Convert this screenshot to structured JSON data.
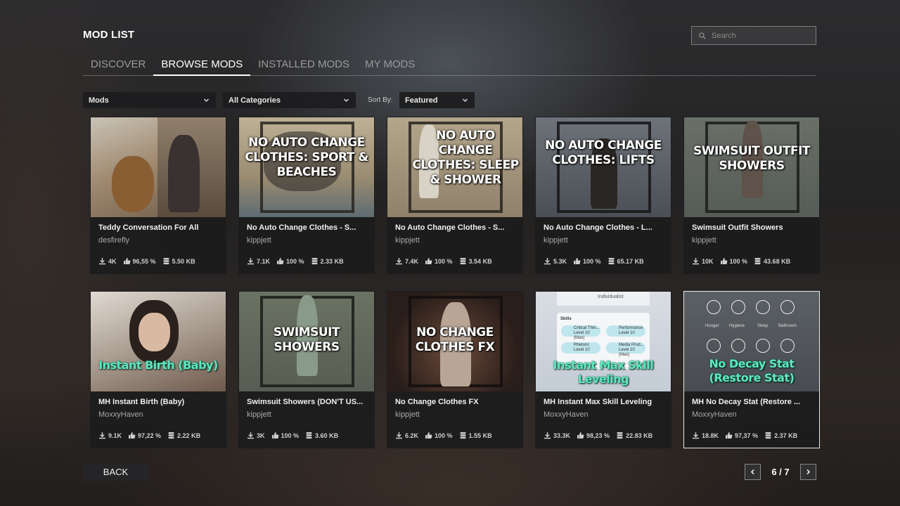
{
  "header": {
    "title": "MOD LIST"
  },
  "search": {
    "placeholder": "Search"
  },
  "tabs": [
    {
      "label": "DISCOVER",
      "active": false
    },
    {
      "label": "BROWSE MODS",
      "active": true
    },
    {
      "label": "INSTALLED MODS",
      "active": false
    },
    {
      "label": "MY MODS",
      "active": false
    }
  ],
  "filters": {
    "type": "Mods",
    "category": "All Categories",
    "sort_label": "Sort By:",
    "sort": "Featured"
  },
  "mods": [
    {
      "name": "Teddy Conversation For All",
      "author": "desfirefly",
      "downloads": "4K",
      "rating": "96,55 %",
      "size": "5.50 KB",
      "thumb_text": ""
    },
    {
      "name": "No Auto Change Clothes - S...",
      "author": "kippjett",
      "downloads": "7.1K",
      "rating": "100 %",
      "size": "2.33 KB",
      "thumb_text": "NO AUTO CHANGE CLOTHES: SPORT & BEACHES"
    },
    {
      "name": "No Auto Change Clothes - S...",
      "author": "kippjett",
      "downloads": "7.4K",
      "rating": "100 %",
      "size": "3.54 KB",
      "thumb_text": "NO AUTO CHANGE CLOTHES: SLEEP & SHOWER"
    },
    {
      "name": "No Auto Change Clothes - L...",
      "author": "kippjett",
      "downloads": "5.3K",
      "rating": "100 %",
      "size": "65.17 KB",
      "thumb_text": "NO AUTO CHANGE CLOTHES: LIFTS"
    },
    {
      "name": "Swimsuit Outfit Showers",
      "author": "kippjett",
      "downloads": "10K",
      "rating": "100 %",
      "size": "43.68 KB",
      "thumb_text": "SWIMSUIT OUTFIT SHOWERS"
    },
    {
      "name": "MH Instant Birth (Baby)",
      "author": "MoxxyHaven",
      "downloads": "9.1K",
      "rating": "97,22 %",
      "size": "2.22 KB",
      "thumb_text": "Instant Birth (Baby)"
    },
    {
      "name": "Swimsuit Showers (DON'T US...",
      "author": "kippjett",
      "downloads": "3K",
      "rating": "100 %",
      "size": "3.60 KB",
      "thumb_text": "SWIMSUIT SHOWERS"
    },
    {
      "name": "No Change Clothes FX",
      "author": "kippjett",
      "downloads": "6.2K",
      "rating": "100 %",
      "size": "1.55 KB",
      "thumb_text": "NO CHANGE CLOTHES FX"
    },
    {
      "name": "MH Instant Max Skill Leveling",
      "author": "MoxxyHaven",
      "downloads": "33.3K",
      "rating": "98,23 %",
      "size": "22.83 KB",
      "thumb_text": "Instant Max Skill Leveling"
    },
    {
      "name": "MH No Decay Stat (Restore ...",
      "author": "MoxxyHaven",
      "downloads": "18.8K",
      "rating": "97,37 %",
      "size": "2.37 KB",
      "thumb_text": "No Decay Stat (Restore Stat)"
    }
  ],
  "thumb_details": {
    "skills": {
      "top": "Individualist",
      "header": "Skills",
      "items": [
        "Critical Thin...",
        "Performance",
        "Rhetoric",
        "Media Prod..."
      ],
      "level": "Level 10",
      "level_max": "Level 10 (Max)"
    },
    "needs": [
      "Hunger",
      "Hygiene",
      "Sleep",
      "Bathroom"
    ]
  },
  "footer": {
    "back_label": "BACK",
    "page": "6 / 7"
  },
  "colors": {
    "accent": "#ffffff",
    "card_bg": "#1c1c1e",
    "teal_text": "#5fe6c0"
  }
}
